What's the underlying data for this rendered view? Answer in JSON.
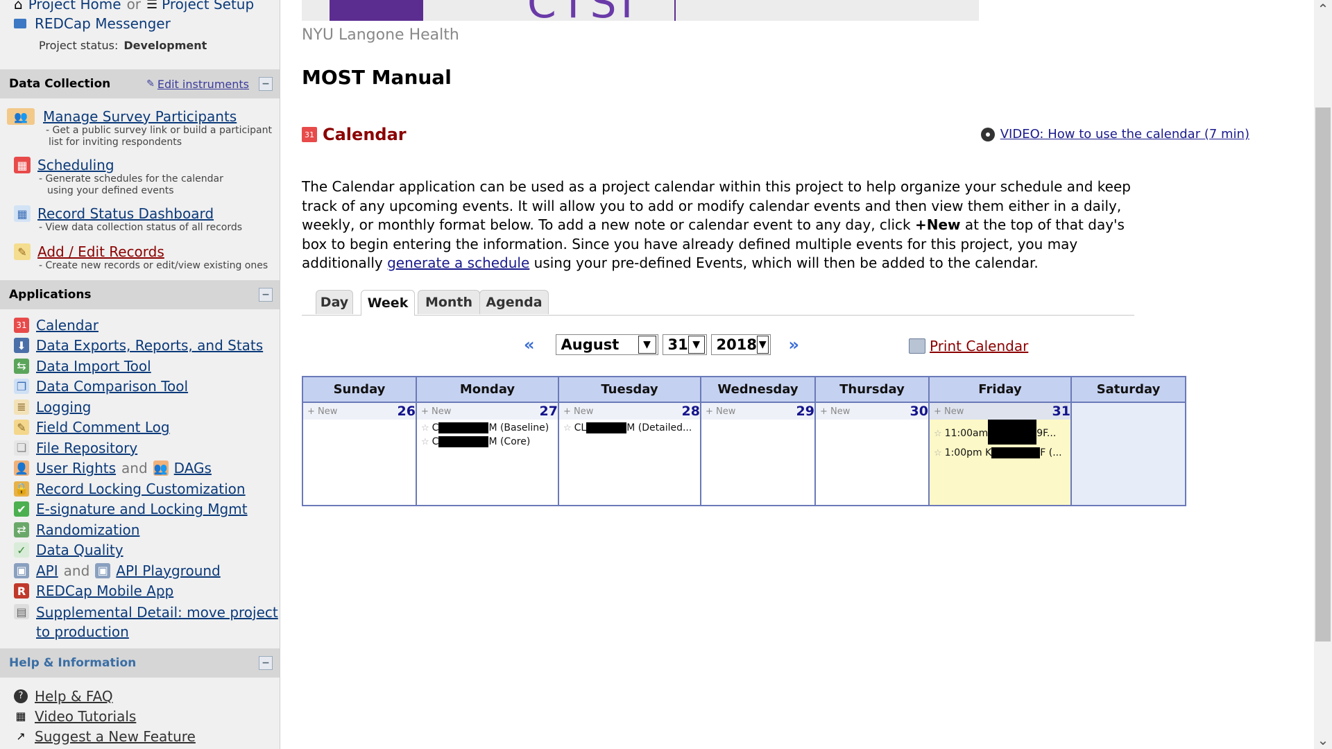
{
  "sidebar": {
    "top": {
      "project_home": "Project Home",
      "or": "or",
      "project_setup": "Project Setup",
      "messenger": "REDCap Messenger",
      "status_label": "Project status:",
      "status_value": "Development"
    },
    "data_collection": {
      "title": "Data Collection",
      "edit_instruments": "Edit instruments",
      "items": [
        {
          "label": "Manage Survey Participants",
          "desc1": "- Get a public survey link or build a participant",
          "desc2": "list for inviting respondents"
        },
        {
          "label": "Scheduling",
          "desc1": "- Generate schedules for the calendar",
          "desc2": "using your defined events"
        },
        {
          "label": "Record Status Dashboard",
          "desc1": "- View data collection status of all records",
          "desc2": ""
        },
        {
          "label": "Add / Edit Records",
          "desc1": "- Create new records or edit/view existing ones",
          "desc2": ""
        }
      ]
    },
    "applications": {
      "title": "Applications",
      "items": {
        "calendar": "Calendar",
        "data_exports": "Data Exports, Reports, and Stats",
        "data_import": "Data Import Tool",
        "data_comparison": "Data Comparison Tool",
        "logging": "Logging",
        "field_comment": "Field Comment Log",
        "file_repository": "File Repository",
        "user_rights": "User Rights",
        "and": "and",
        "dags": "DAGs",
        "record_locking": "Record Locking Customization",
        "esignature": "E-signature and Locking Mgmt",
        "randomization": "Randomization",
        "data_quality": "Data Quality",
        "api": "API",
        "api_playground": "API Playground",
        "mobile_app": "REDCap Mobile App",
        "supplemental1": "Supplemental Detail: move project",
        "supplemental2": "to production"
      }
    },
    "help": {
      "title": "Help & Information",
      "items": {
        "faq": "Help & FAQ",
        "video": "Video Tutorials",
        "suggest": "Suggest a New Feature"
      }
    }
  },
  "main": {
    "org": "NYU Langone Health",
    "banner_text": "CTSI",
    "project_title": "MOST Manual",
    "calendar_title": "Calendar",
    "video_link": "VIDEO: How to use the calendar (7 min)",
    "intro": {
      "p1": "The Calendar application can be used as a project calendar within this project to help organize your schedule and keep track of any upcoming events. It will allow you to add or modify calendar events and then view them either in a daily, weekly, or monthly format below. To add a new note or calendar event to any day, click ",
      "bold": "+New",
      "p2": " at the top of that day's box to begin entering the information. Since you have already defined multiple events for this project, you may additionally ",
      "link": "generate a schedule",
      "p3": " using your pre-defined Events, which will then be added to the calendar."
    },
    "tabs": [
      "Day",
      "Week",
      "Month",
      "Agenda"
    ],
    "active_tab": "Week",
    "month": "August",
    "day": "31",
    "year": "2018",
    "print": "Print Calendar",
    "new_label": "+ New",
    "days": [
      {
        "name": "Sunday",
        "num": "26",
        "events": []
      },
      {
        "name": "Monday",
        "num": "27",
        "events": [
          {
            "pre": "C",
            "post": "M (Baseline)"
          },
          {
            "pre": "C",
            "post": "M (Core)"
          }
        ]
      },
      {
        "name": "Tuesday",
        "num": "28",
        "events": [
          {
            "pre": "CL",
            "post": "M (Detailed..."
          }
        ]
      },
      {
        "name": "Wednesday",
        "num": "29",
        "events": []
      },
      {
        "name": "Thursday",
        "num": "30",
        "events": []
      },
      {
        "name": "Friday",
        "num": "31",
        "events": [
          {
            "pre": "11:00am ",
            "post": "9F..."
          },
          {
            "pre": "1:00pm K",
            "post": "F (..."
          }
        ]
      },
      {
        "name": "Saturday",
        "num": "",
        "events": []
      }
    ]
  }
}
